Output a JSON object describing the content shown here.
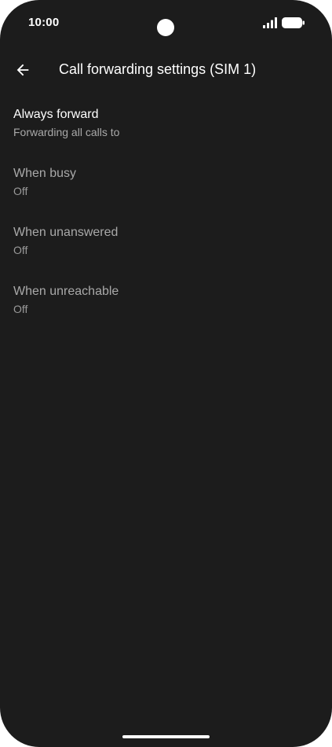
{
  "status_bar": {
    "time": "10:00",
    "signal_icon": "cellular-signal-icon",
    "battery_icon": "battery-full-icon"
  },
  "app_bar": {
    "back_icon": "arrow-back-icon",
    "title": "Call forwarding settings (SIM 1)"
  },
  "settings": {
    "items": [
      {
        "title": "Always forward",
        "summary": "Forwarding all calls to",
        "enabled": true
      },
      {
        "title": "When busy",
        "summary": "Off",
        "enabled": false
      },
      {
        "title": "When unanswered",
        "summary": "Off",
        "enabled": false
      },
      {
        "title": "When unreachable",
        "summary": "Off",
        "enabled": false
      }
    ]
  },
  "colors": {
    "background": "#1c1c1c",
    "primary_text": "#ffffff",
    "secondary_text": "#a9a9a9"
  }
}
